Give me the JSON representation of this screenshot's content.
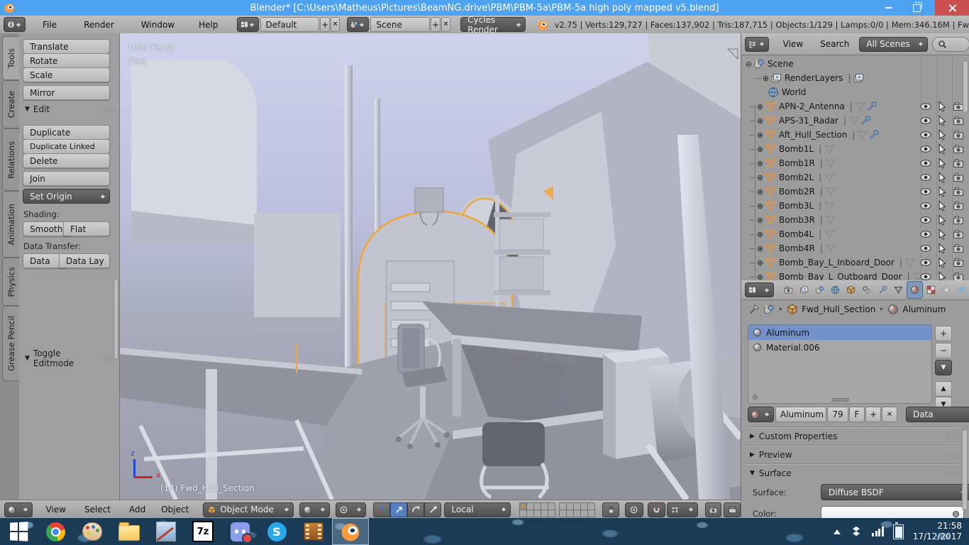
{
  "icons": {
    "tri_down": "▼",
    "tri_right": "▶",
    "tri_up": "▲",
    "plus": "+",
    "x": "✕",
    "minus": "−",
    "expander_open": "⊖",
    "expander_closed": "⊕",
    "pipe": "|",
    "grip": "::::",
    "crumb_sep": "‣"
  },
  "titlebar": {
    "title": "Blender* [C:\\Users\\Matheus\\Pictures\\BeamNG.drive\\PBM\\PBM-5a\\PBM-5a high poly mapped v5.blend]"
  },
  "infobar": {
    "menus": [
      "File",
      "Render",
      "Window",
      "Help"
    ],
    "layout": "Default",
    "scene": "Scene",
    "engine": "Cycles Render",
    "stats": "v2.75 | Verts:129,727 | Faces:137,902 | Tris:187,715 | Objects:1/129 | Lamps:0/0 | Mem:346.16M | Fw"
  },
  "toolshelf": {
    "tabs": [
      "Tools",
      "Create",
      "Relations",
      "Animation",
      "Physics",
      "Grease Pencil"
    ],
    "transform": [
      "Translate",
      "Rotate",
      "Scale"
    ],
    "mirror": "Mirror",
    "edit": {
      "title": "Edit",
      "buttons": [
        "Duplicate",
        "Duplicate Linked",
        "Delete"
      ],
      "join": "Join",
      "set_origin": "Set Origin",
      "shading_label": "Shading:",
      "shading": [
        "Smooth",
        "Flat"
      ],
      "data_transfer_label": "Data Transfer:",
      "data_transfer": [
        "Data",
        "Data Lay"
      ]
    },
    "bottom_panel": "Toggle Editmode"
  },
  "viewport": {
    "view_label": "User Persp",
    "unit_label": "Feet",
    "object_label": "(14) Fwd_Hull_Section",
    "axis": {
      "x": "x",
      "z": "z"
    }
  },
  "view3d_header": {
    "menus": [
      "View",
      "Select",
      "Add",
      "Object"
    ],
    "mode": "Object Mode",
    "orientation": "Local"
  },
  "outliner": {
    "header": {
      "view": "View",
      "search": "Search",
      "scenes": "All Scenes"
    },
    "items": [
      {
        "label": "Scene"
      },
      {
        "label": "RenderLayers"
      },
      {
        "label": "World"
      },
      {
        "label": "APN-2_Antenna"
      },
      {
        "label": "APS-31_Radar"
      },
      {
        "label": "Aft_Hull_Section"
      },
      {
        "label": "Bomb1L"
      },
      {
        "label": "Bomb1R"
      },
      {
        "label": "Bomb2L"
      },
      {
        "label": "Bomb2R"
      },
      {
        "label": "Bomb3L"
      },
      {
        "label": "Bomb3R"
      },
      {
        "label": "Bomb4L"
      },
      {
        "label": "Bomb4R"
      },
      {
        "label": "Bomb_Bay_L_Inboard_Door"
      },
      {
        "label": "Bomb_Bay_L_Outboard_Door"
      }
    ]
  },
  "properties": {
    "breadcrumb": {
      "object": "Fwd_Hull_Section",
      "material": "Aluminum"
    },
    "slots": [
      "Aluminum",
      "Material.006"
    ],
    "datablock": {
      "name": "Aluminum",
      "users": "79",
      "fake": "F"
    },
    "link": "Data",
    "panels": {
      "custom_properties": "Custom Properties",
      "preview": "Preview",
      "surface": "Surface"
    },
    "surface_label": "Surface:",
    "surface_value": "Diffuse BSDF",
    "color_label": "Color:"
  },
  "taskbar": {
    "labels": {
      "sevenzip": "7z",
      "skype": "S"
    },
    "clock": {
      "time": "21:58",
      "date": "17/12/2017"
    }
  },
  "colors": {
    "titlebar_blue": "#4da2f1",
    "selection_orange": "#f2a636",
    "slot_selected_blue": "#7191c8",
    "close_red": "#c9504f"
  }
}
